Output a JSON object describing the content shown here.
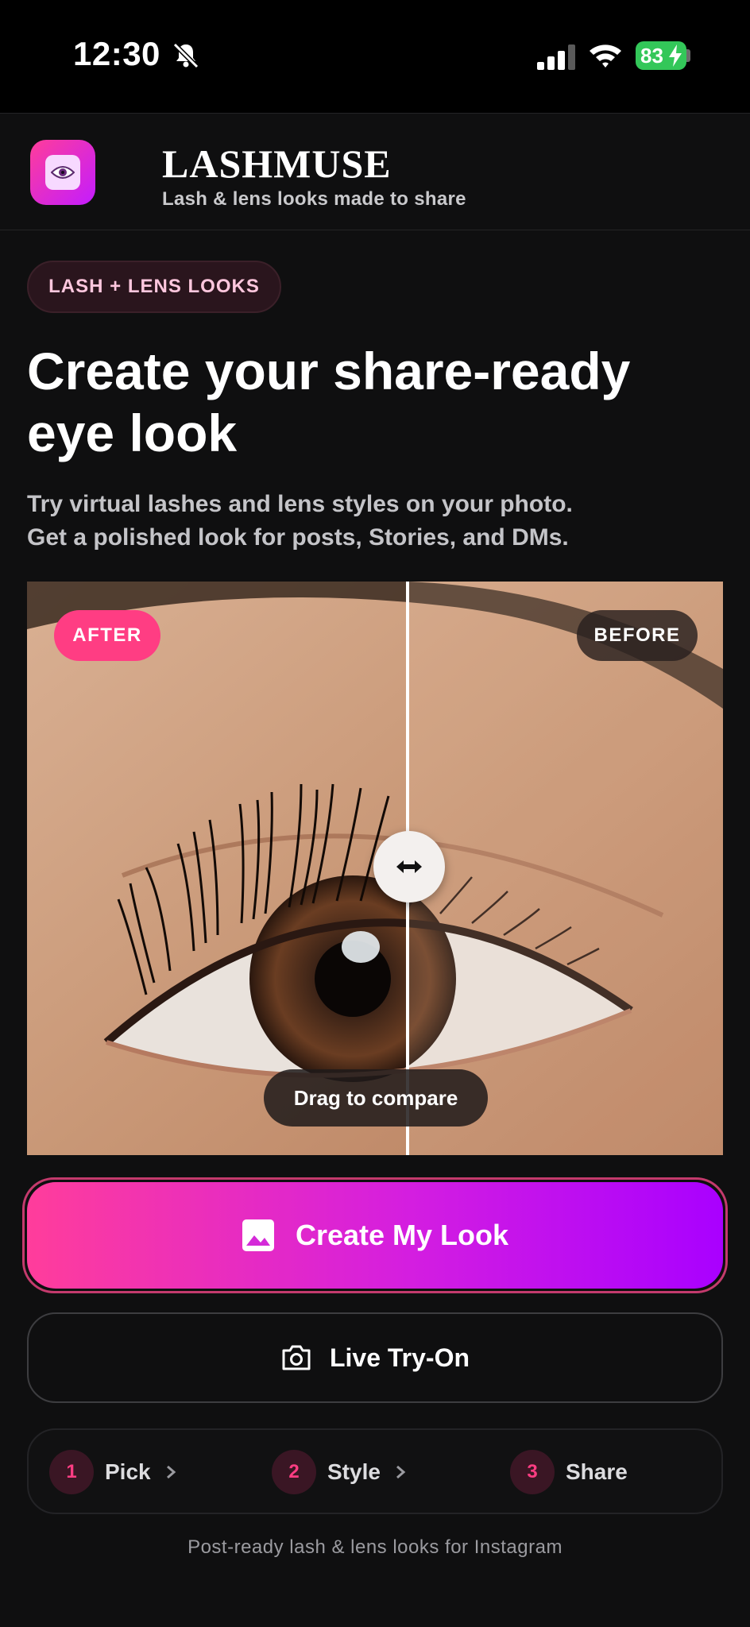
{
  "status_bar": {
    "time": "12:30",
    "battery": "83"
  },
  "header": {
    "brand": "LASHMUSE",
    "tagline": "Lash & lens looks made to share",
    "logo_icon": "eye-icon"
  },
  "hero": {
    "tag": "LASH + LENS LOOKS",
    "title": "Create your share-ready eye look",
    "subtitle_line1": "Try virtual lashes and lens styles on your photo.",
    "subtitle_line2": "Get a polished look for posts, Stories, and DMs."
  },
  "compare": {
    "after_label": "AFTER",
    "before_label": "BEFORE",
    "hint": "Drag to compare",
    "handle_icon": "arrows-horizontal-icon"
  },
  "actions": {
    "create_label": "Create My Look",
    "create_icon": "image-icon",
    "live_label": "Live Try-On",
    "live_icon": "camera-icon"
  },
  "steps": [
    {
      "num": "1",
      "label": "Pick"
    },
    {
      "num": "2",
      "label": "Style"
    },
    {
      "num": "3",
      "label": "Share"
    }
  ],
  "footer": "Post-ready lash & lens looks for Instagram",
  "colors": {
    "accent_pink": "#ff3d83",
    "accent_purple": "#a900ff",
    "background": "#0f0f10"
  }
}
